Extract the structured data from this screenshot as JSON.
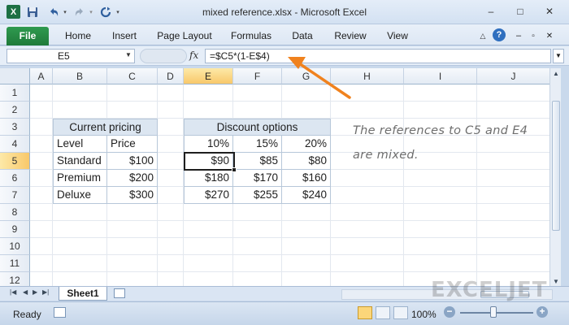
{
  "window": {
    "title": "mixed reference.xlsx  -  Microsoft Excel",
    "app_icon": "X",
    "minimize_icon": "–",
    "restore_icon": "□",
    "close_icon": "✕"
  },
  "quick_access": {
    "save_icon": "save-icon",
    "undo_icon": "undo-icon",
    "redo_icon": "redo-icon",
    "refresh_icon": "refresh-icon"
  },
  "ribbon": {
    "tabs": [
      "File",
      "Home",
      "Insert",
      "Page Layout",
      "Formulas",
      "Data",
      "Review",
      "View"
    ]
  },
  "formula_bar": {
    "name_box": "E5",
    "fx": "fx",
    "formula": "=$C5*(1-E$4)"
  },
  "grid": {
    "columns": [
      "A",
      "B",
      "C",
      "D",
      "E",
      "F",
      "G",
      "H",
      "I",
      "J"
    ],
    "rows": [
      "1",
      "2",
      "3",
      "4",
      "5",
      "6",
      "7",
      "8",
      "9",
      "10",
      "11",
      "12"
    ],
    "selected_column": "E",
    "selected_row": "5"
  },
  "pricing_table": {
    "title": "Current pricing",
    "header_level": "Level",
    "header_price": "Price",
    "rows": [
      {
        "level": "Standard",
        "price": "$100"
      },
      {
        "level": "Premium",
        "price": "$200"
      },
      {
        "level": "Deluxe",
        "price": "$300"
      }
    ]
  },
  "discount_table": {
    "title": "Discount options",
    "discounts": [
      "10%",
      "15%",
      "20%"
    ],
    "values": [
      [
        "$90",
        "$85",
        "$80"
      ],
      [
        "$180",
        "$170",
        "$160"
      ],
      [
        "$270",
        "$255",
        "$240"
      ]
    ]
  },
  "note": "The references to C5 and E4 are mixed.",
  "sheet_tabs": [
    "Sheet1"
  ],
  "watermark": "EXCELJET",
  "status": {
    "ready": "Ready",
    "zoom": "100%"
  },
  "colors": {
    "file_tab": "#1f7a3a",
    "header_fill": "#dce6f1",
    "selected_header": "#f8c86a",
    "annotation_arrow": "#f0821e"
  }
}
